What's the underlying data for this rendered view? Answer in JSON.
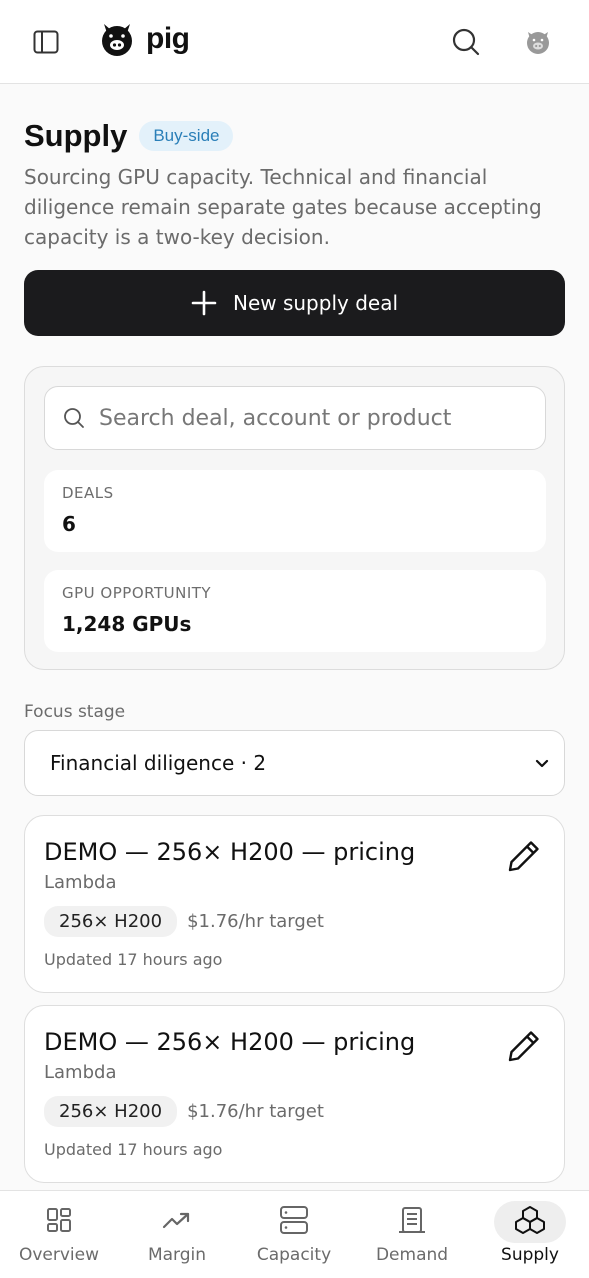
{
  "header": {
    "brand": "pig"
  },
  "page": {
    "title": "Supply",
    "badge": "Buy-side",
    "subtitle": "Sourcing GPU capacity. Technical and financial diligence remain separate gates because accepting capacity is a two-key decision.",
    "new_deal_label": "New supply deal"
  },
  "filters": {
    "search_placeholder": "Search deal, account or product",
    "deals_label": "DEALS",
    "deals_value": "6",
    "gpu_label": "GPU OPPORTUNITY",
    "gpu_value": "1,248 GPUs",
    "focus_label": "Focus stage",
    "focus_value": "Financial diligence · 2"
  },
  "deals": [
    {
      "title": "DEMO — 256× H200 — pricing",
      "account": "Lambda",
      "chip": "256× H200",
      "target": "$1.76/hr target",
      "updated": "Updated 17 hours ago"
    },
    {
      "title": "DEMO — 256× H200 — pricing",
      "account": "Lambda",
      "chip": "256× H200",
      "target": "$1.76/hr target",
      "updated": "Updated 17 hours ago"
    }
  ],
  "nav": {
    "items": [
      {
        "label": "Overview",
        "icon": "grid-icon"
      },
      {
        "label": "Margin",
        "icon": "trend-up-icon"
      },
      {
        "label": "Capacity",
        "icon": "server-icon"
      },
      {
        "label": "Demand",
        "icon": "building-icon"
      },
      {
        "label": "Supply",
        "icon": "boxes-icon"
      }
    ],
    "active": "Supply"
  },
  "colors": {
    "accent_dark": "#1b1b1d",
    "badge_bg": "#e3f1fa",
    "badge_text": "#2a7fb8"
  }
}
